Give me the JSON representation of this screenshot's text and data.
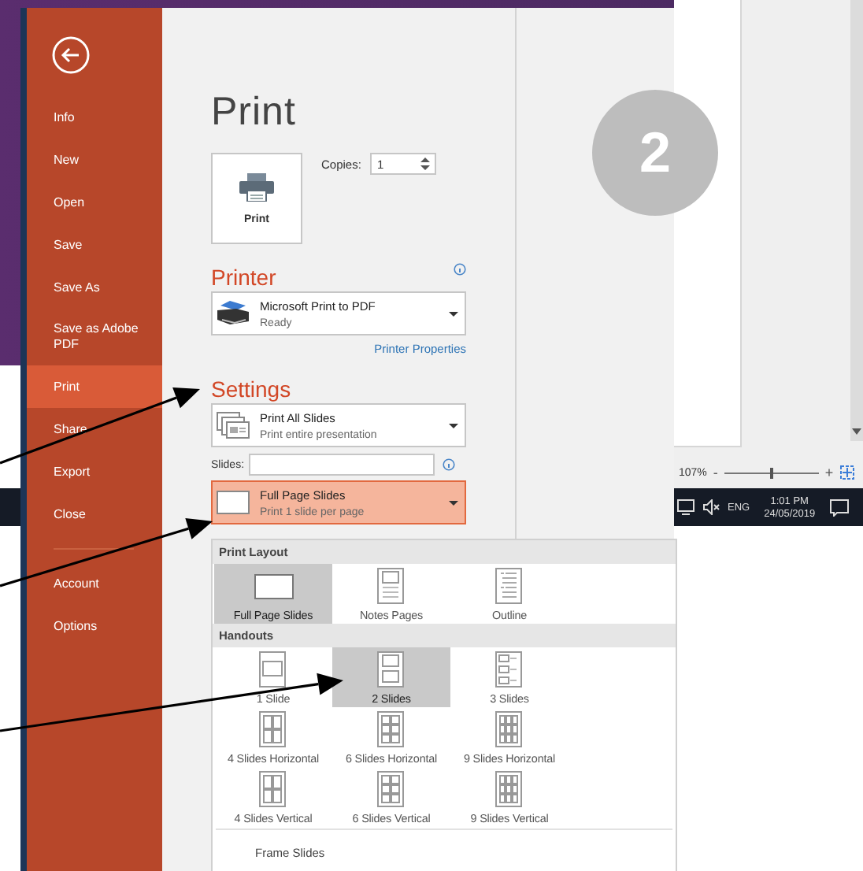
{
  "sidebar": {
    "items": [
      {
        "label": "Info",
        "selected": false
      },
      {
        "label": "New",
        "selected": false
      },
      {
        "label": "Open",
        "selected": false
      },
      {
        "label": "Save",
        "selected": false
      },
      {
        "label": "Save As",
        "selected": false
      },
      {
        "label": "Save as Adobe PDF",
        "selected": false
      },
      {
        "label": "Print",
        "selected": true
      },
      {
        "label": "Share",
        "selected": false
      },
      {
        "label": "Export",
        "selected": false
      },
      {
        "label": "Close",
        "selected": false
      }
    ],
    "footer_items": [
      {
        "label": "Account",
        "selected": false
      },
      {
        "label": "Options",
        "selected": false
      }
    ]
  },
  "print_panel": {
    "title": "Print",
    "print_button": "Print",
    "copies_label": "Copies:",
    "copies_value": "1",
    "printer": {
      "heading": "Printer",
      "name": "Microsoft Print to PDF",
      "status": "Ready",
      "properties_link": "Printer Properties"
    },
    "settings": {
      "heading": "Settings",
      "range": {
        "title": "Print All Slides",
        "subtitle": "Print entire presentation"
      },
      "slides_label": "Slides:",
      "layout": {
        "title": "Full Page Slides",
        "subtitle": "Print 1 slide per page",
        "expanded": true
      }
    }
  },
  "layout_menu": {
    "sections": [
      {
        "heading": "Print Layout",
        "options": [
          {
            "label": "Full Page Slides",
            "kind": "full",
            "selected": true
          },
          {
            "label": "Notes Pages",
            "kind": "notes",
            "selected": false
          },
          {
            "label": "Outline",
            "kind": "outline",
            "selected": false
          }
        ]
      },
      {
        "heading": "Handouts",
        "options": [
          {
            "label": "1 Slide",
            "kind": "one",
            "selected": false
          },
          {
            "label": "2 Slides",
            "kind": "two",
            "selected": true
          },
          {
            "label": "3 Slides",
            "kind": "three",
            "selected": false
          },
          {
            "label": "4 Slides Horizontal",
            "kind": "grid4",
            "selected": false
          },
          {
            "label": "6 Slides Horizontal",
            "kind": "grid6",
            "selected": false
          },
          {
            "label": "9 Slides Horizontal",
            "kind": "grid9",
            "selected": false
          },
          {
            "label": "4 Slides Vertical",
            "kind": "grid4",
            "selected": false
          },
          {
            "label": "6 Slides Vertical",
            "kind": "grid6",
            "selected": false
          },
          {
            "label": "9 Slides Vertical",
            "kind": "grid9",
            "selected": false
          }
        ]
      }
    ],
    "commands": [
      {
        "label": "Frame Slides"
      }
    ]
  },
  "zoom_bar": {
    "zoom": "107%",
    "minus": "-",
    "plus": "+",
    "level": 0.5
  },
  "taskbar": {
    "language": "ENG",
    "time": "1:01 PM",
    "date": "24/05/2019"
  },
  "step_badge": "2"
}
